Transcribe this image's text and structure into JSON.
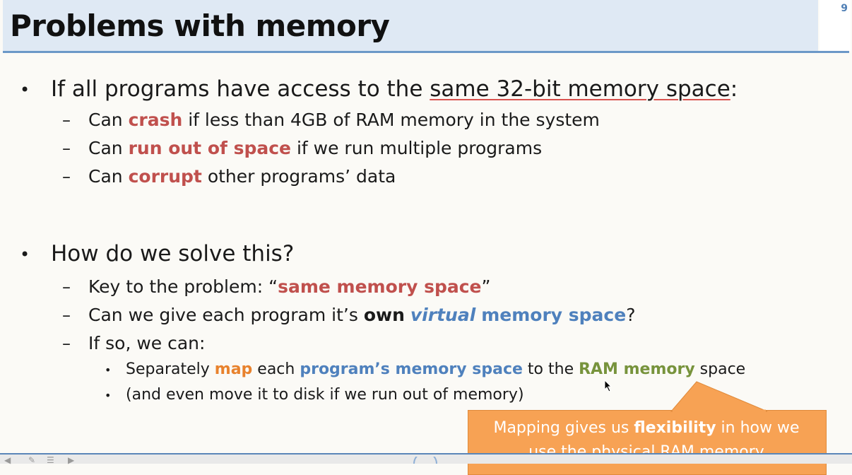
{
  "slide": {
    "title": "Problems with memory",
    "number": "9"
  },
  "bullets": [
    {
      "text_before": "If all programs have access to the ",
      "underlined": "same 32-bit memory space",
      "text_after": ":",
      "subs": [
        {
          "pre": "Can ",
          "hl": "crash",
          "post": " if less than 4GB of RAM memory in the system"
        },
        {
          "pre": "Can ",
          "hl": "run out of space",
          "post": " if we run multiple programs"
        },
        {
          "pre": "Can ",
          "hl": "corrupt",
          "post": " other programs’ data"
        }
      ]
    },
    {
      "text": "How do we solve this?",
      "sub1": {
        "pre": "Key to the problem: “",
        "hl": "same memory space",
        "post": "”"
      },
      "sub2": {
        "pre": "Can we give each program it’s ",
        "own": "own",
        "virtual": "virtual",
        "mem": "memory space",
        "post": "?"
      },
      "sub3": "If so, we can:",
      "sub3_items": [
        {
          "a": "Separately ",
          "map": "map",
          "b": " each ",
          "prog": "program’s memory space",
          "c": " to the ",
          "ram": "RAM memory",
          "d": " space"
        },
        {
          "text": "(and even move it to disk if we run out of memory)"
        }
      ]
    }
  ],
  "callout": {
    "pre": "Mapping gives us ",
    "bold": "flexibility",
    "post": " in how we",
    "line2": "use the physical RAM memory"
  },
  "glyphs": {
    "bullet": "•",
    "dash": "–"
  },
  "colors": {
    "red": "#c0504d",
    "blue": "#4f81bd",
    "orange": "#e8822d",
    "green": "#77933c",
    "callout": "#f7a254"
  }
}
